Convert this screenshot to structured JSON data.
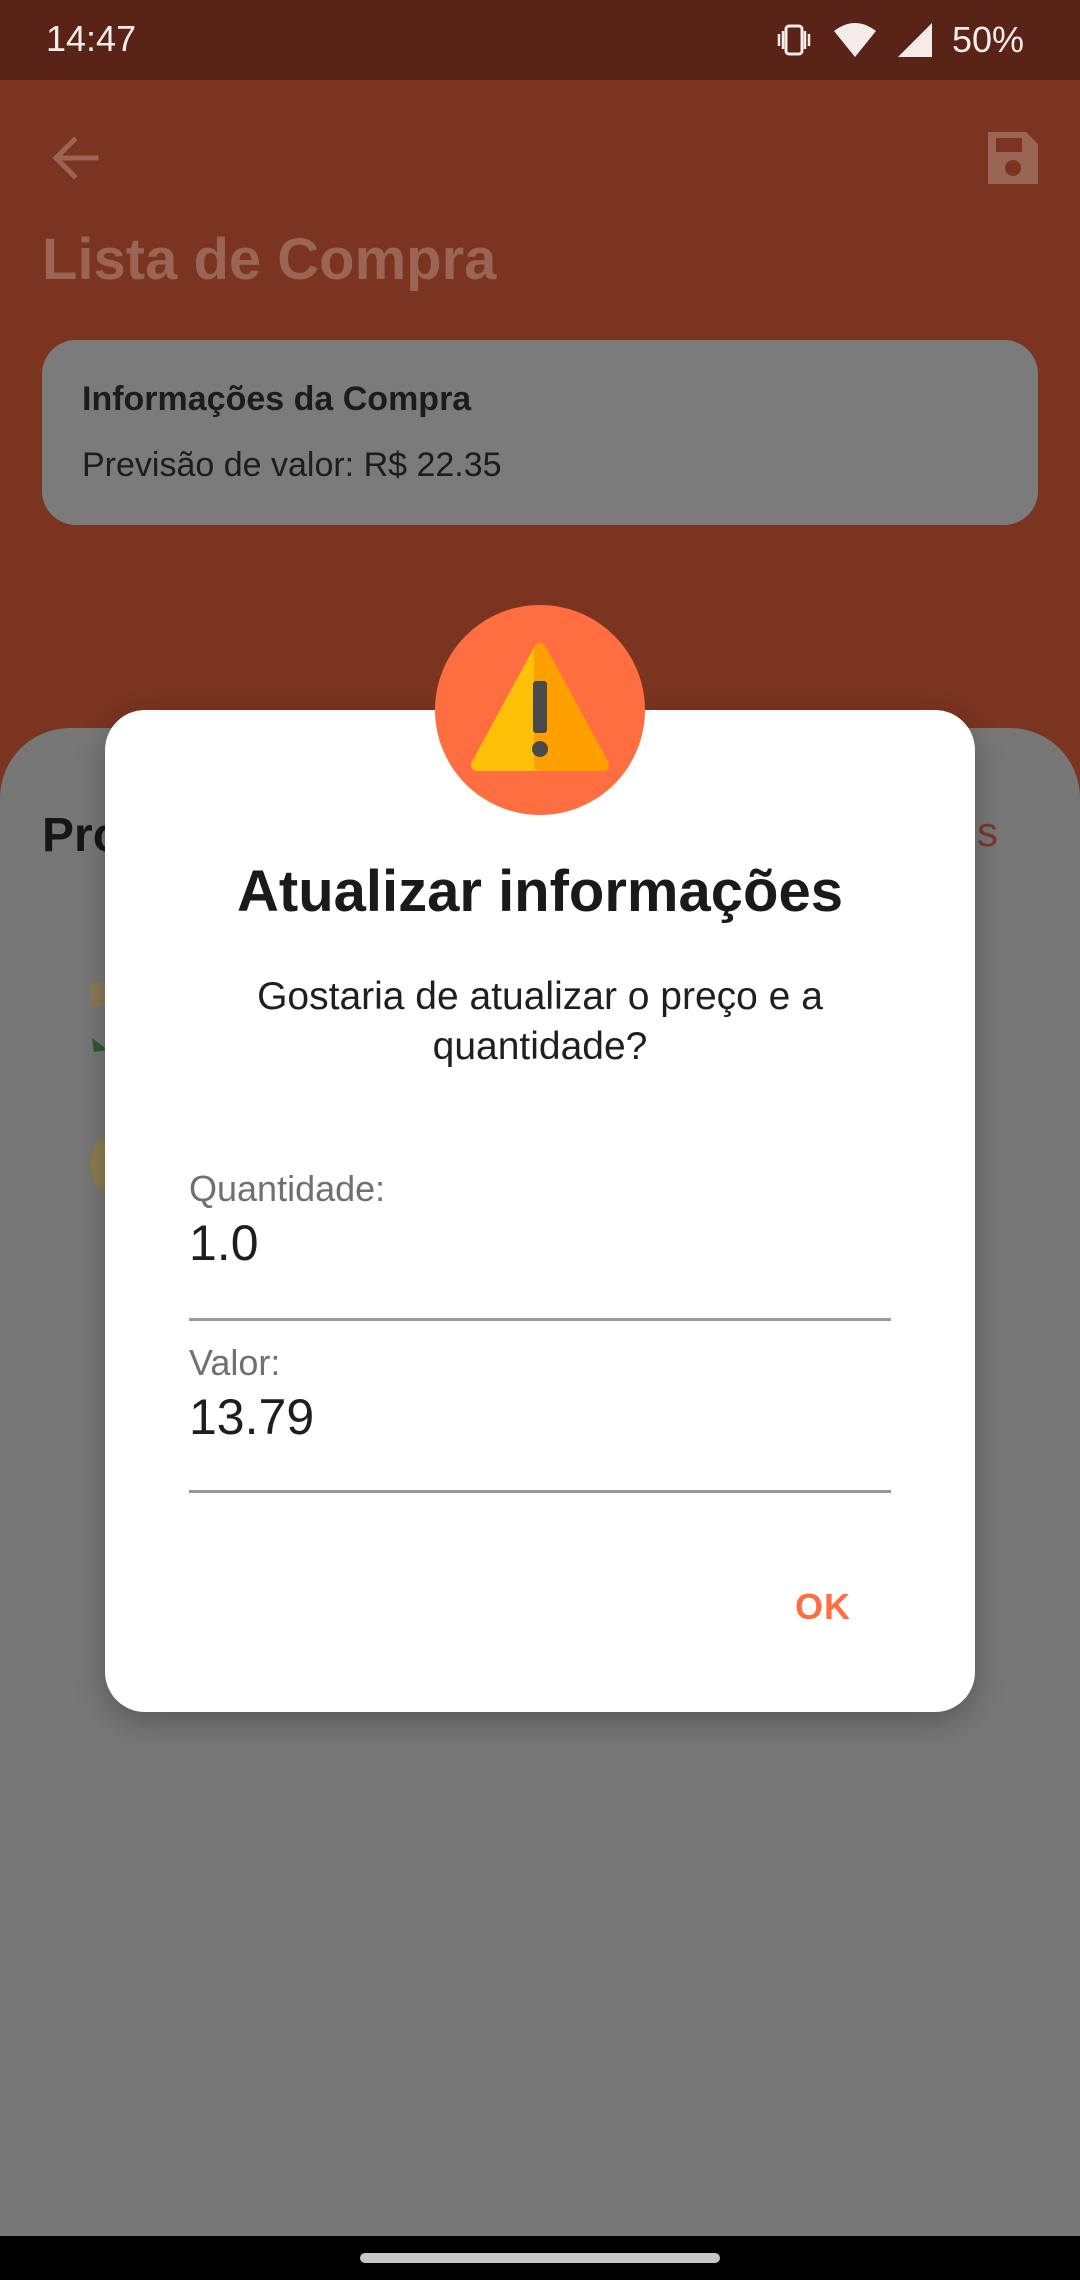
{
  "status_bar": {
    "time": "14:47",
    "battery": "50%",
    "icons": [
      "vibrate-icon",
      "wifi-icon",
      "signal-icon"
    ]
  },
  "header": {
    "title": "Lista de Compra",
    "back_icon": "arrow-back-icon",
    "save_icon": "floppy-save-icon"
  },
  "purchase_info": {
    "title": "Informações da Compra",
    "forecast": "Previsão de valor: R$ 22.35"
  },
  "products": {
    "heading_partial": "Pro",
    "action_partial": "s"
  },
  "dialog": {
    "icon": "warning-icon",
    "title": "Atualizar informações",
    "message": "Gostaria de atualizar o preço e a quantidade?",
    "quantity_label": "Quantidade:",
    "quantity_value": "1.0",
    "value_label": "Valor:",
    "value_value": "13.79",
    "ok_label": "OK"
  },
  "colors": {
    "accent": "#ff6e40",
    "header_dimmed": "#7a3420",
    "statusbar_dimmed": "#5a2318",
    "dialog_bg": "#ffffff"
  }
}
